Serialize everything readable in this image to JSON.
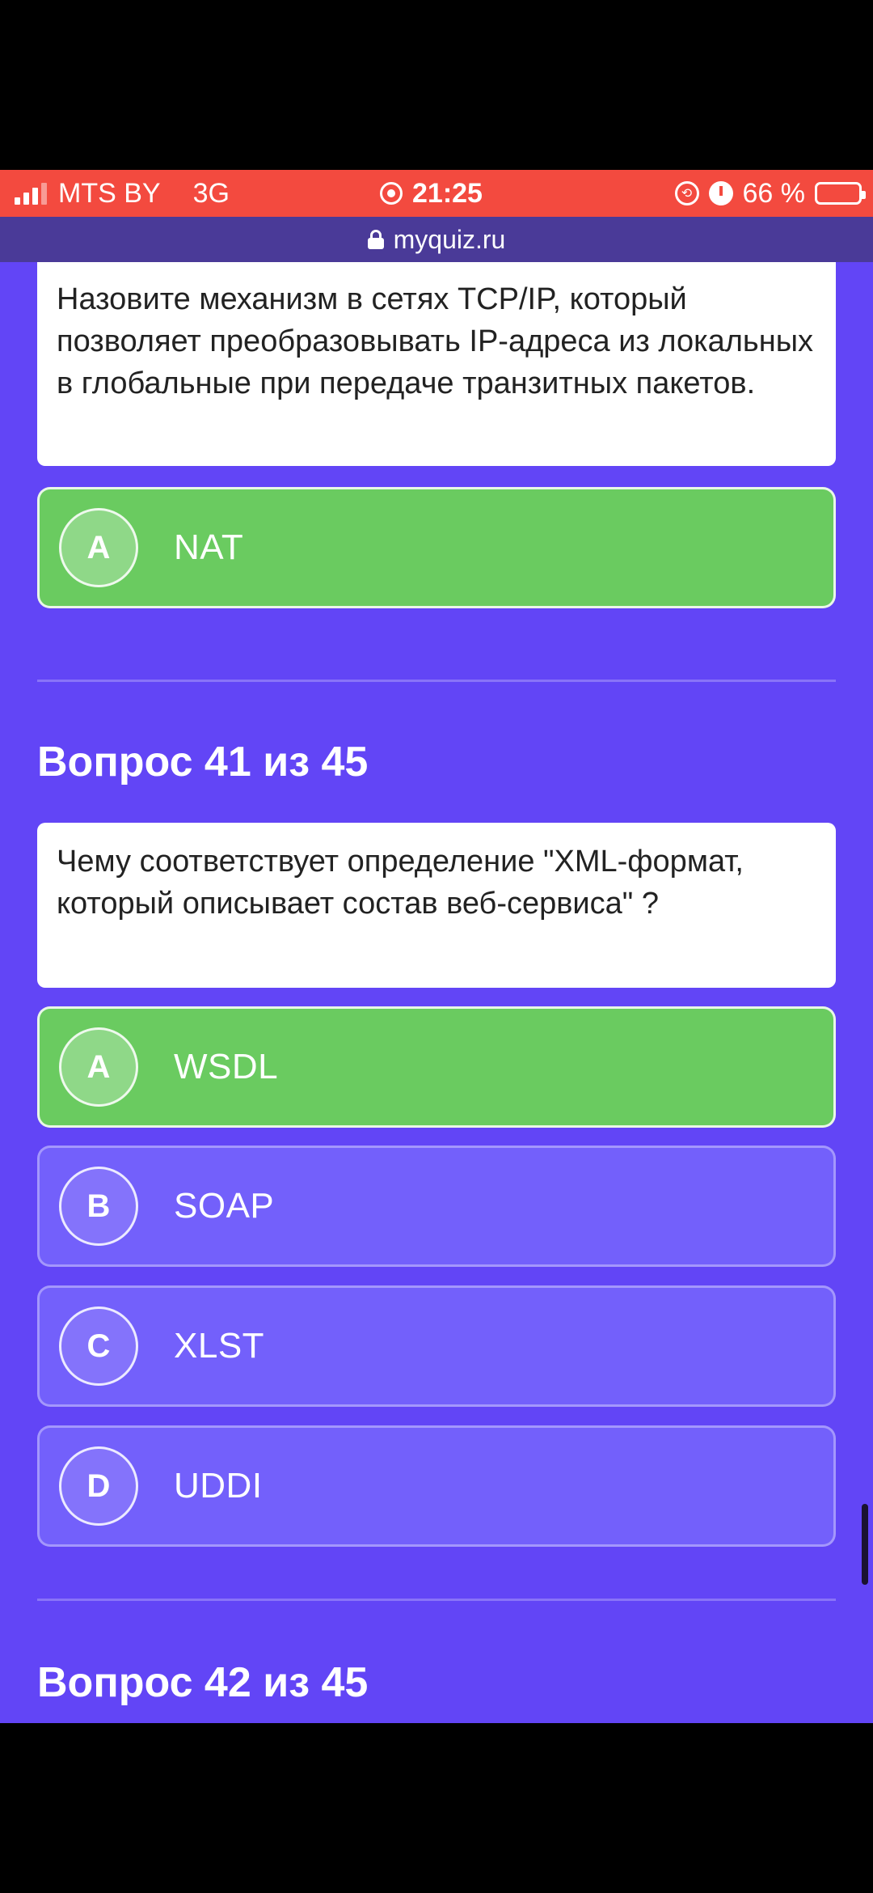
{
  "status": {
    "carrier": "MTS BY",
    "network": "3G",
    "time": "21:25",
    "battery": "66 %",
    "battery_level": 0.66
  },
  "browser": {
    "url": "myquiz.ru"
  },
  "question_40": {
    "text": "Назовите механизм в сетях TCP/IP, который позволяет преобразовывать IP-адреса из локальных в глобальные при передаче транзитных пакетов.",
    "options": [
      {
        "letter": "A",
        "label": "NAT",
        "state": "correct"
      }
    ]
  },
  "question_41": {
    "title": "Вопрос 41 из 45",
    "text": "Чему соответствует определение \"XML-формат, который описывает состав веб-сервиса\" ?",
    "options": [
      {
        "letter": "A",
        "label": "WSDL",
        "state": "correct"
      },
      {
        "letter": "B",
        "label": "SOAP",
        "state": "default"
      },
      {
        "letter": "C",
        "label": "XLST",
        "state": "default"
      },
      {
        "letter": "D",
        "label": "UDDI",
        "state": "default"
      }
    ]
  },
  "question_42": {
    "title": "Вопрос 42 из 45"
  },
  "colors": {
    "status_bar": "#f34a3f",
    "url_bar": "#4a3a98",
    "background": "#6245f6",
    "option": "#7360fb",
    "correct": "#6acb60"
  }
}
